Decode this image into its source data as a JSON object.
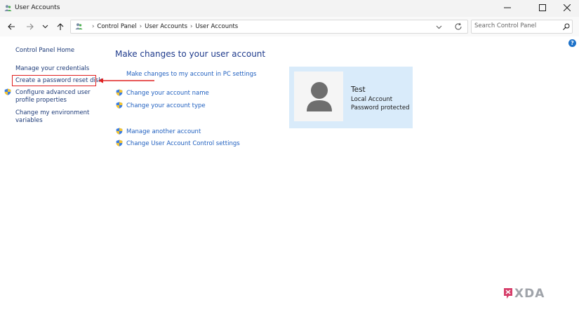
{
  "window": {
    "title": "User Accounts"
  },
  "address": {
    "crumbs": [
      "Control Panel",
      "User Accounts",
      "User Accounts"
    ]
  },
  "search": {
    "placeholder": "Search Control Panel"
  },
  "help": {
    "label": "?"
  },
  "sidebar": {
    "items": [
      {
        "label": "Control Panel Home"
      },
      {
        "label": "Manage your credentials"
      },
      {
        "label": "Create a password reset disk"
      },
      {
        "label_lines": [
          "Configure advanced user",
          "profile properties"
        ]
      },
      {
        "label_lines": [
          "Change my environment",
          "variables"
        ]
      }
    ]
  },
  "main": {
    "heading": "Make changes to your user account",
    "pc_settings_link": "Make changes to my account in PC settings",
    "links": [
      {
        "label": "Change your account name"
      },
      {
        "label": "Change your account type"
      },
      {
        "label": "Manage another account"
      },
      {
        "label": "Change User Account Control settings"
      }
    ]
  },
  "account": {
    "name": "Test",
    "type": "Local Account",
    "status": "Password protected"
  },
  "watermark": {
    "text": "XDA"
  },
  "colors": {
    "accent": "#1f5fbf",
    "heading": "#1f3b8c",
    "annotation": "#e02020",
    "card": "#d9ebfa"
  },
  "icons": [
    "users-icon",
    "minimize-icon",
    "maximize-icon",
    "close-icon",
    "back-arrow-icon",
    "forward-arrow-icon",
    "chevron-down-icon",
    "up-arrow-icon",
    "refresh-icon",
    "search-icon",
    "help-icon",
    "shield-icon",
    "avatar-icon",
    "red-arrow-icon"
  ]
}
